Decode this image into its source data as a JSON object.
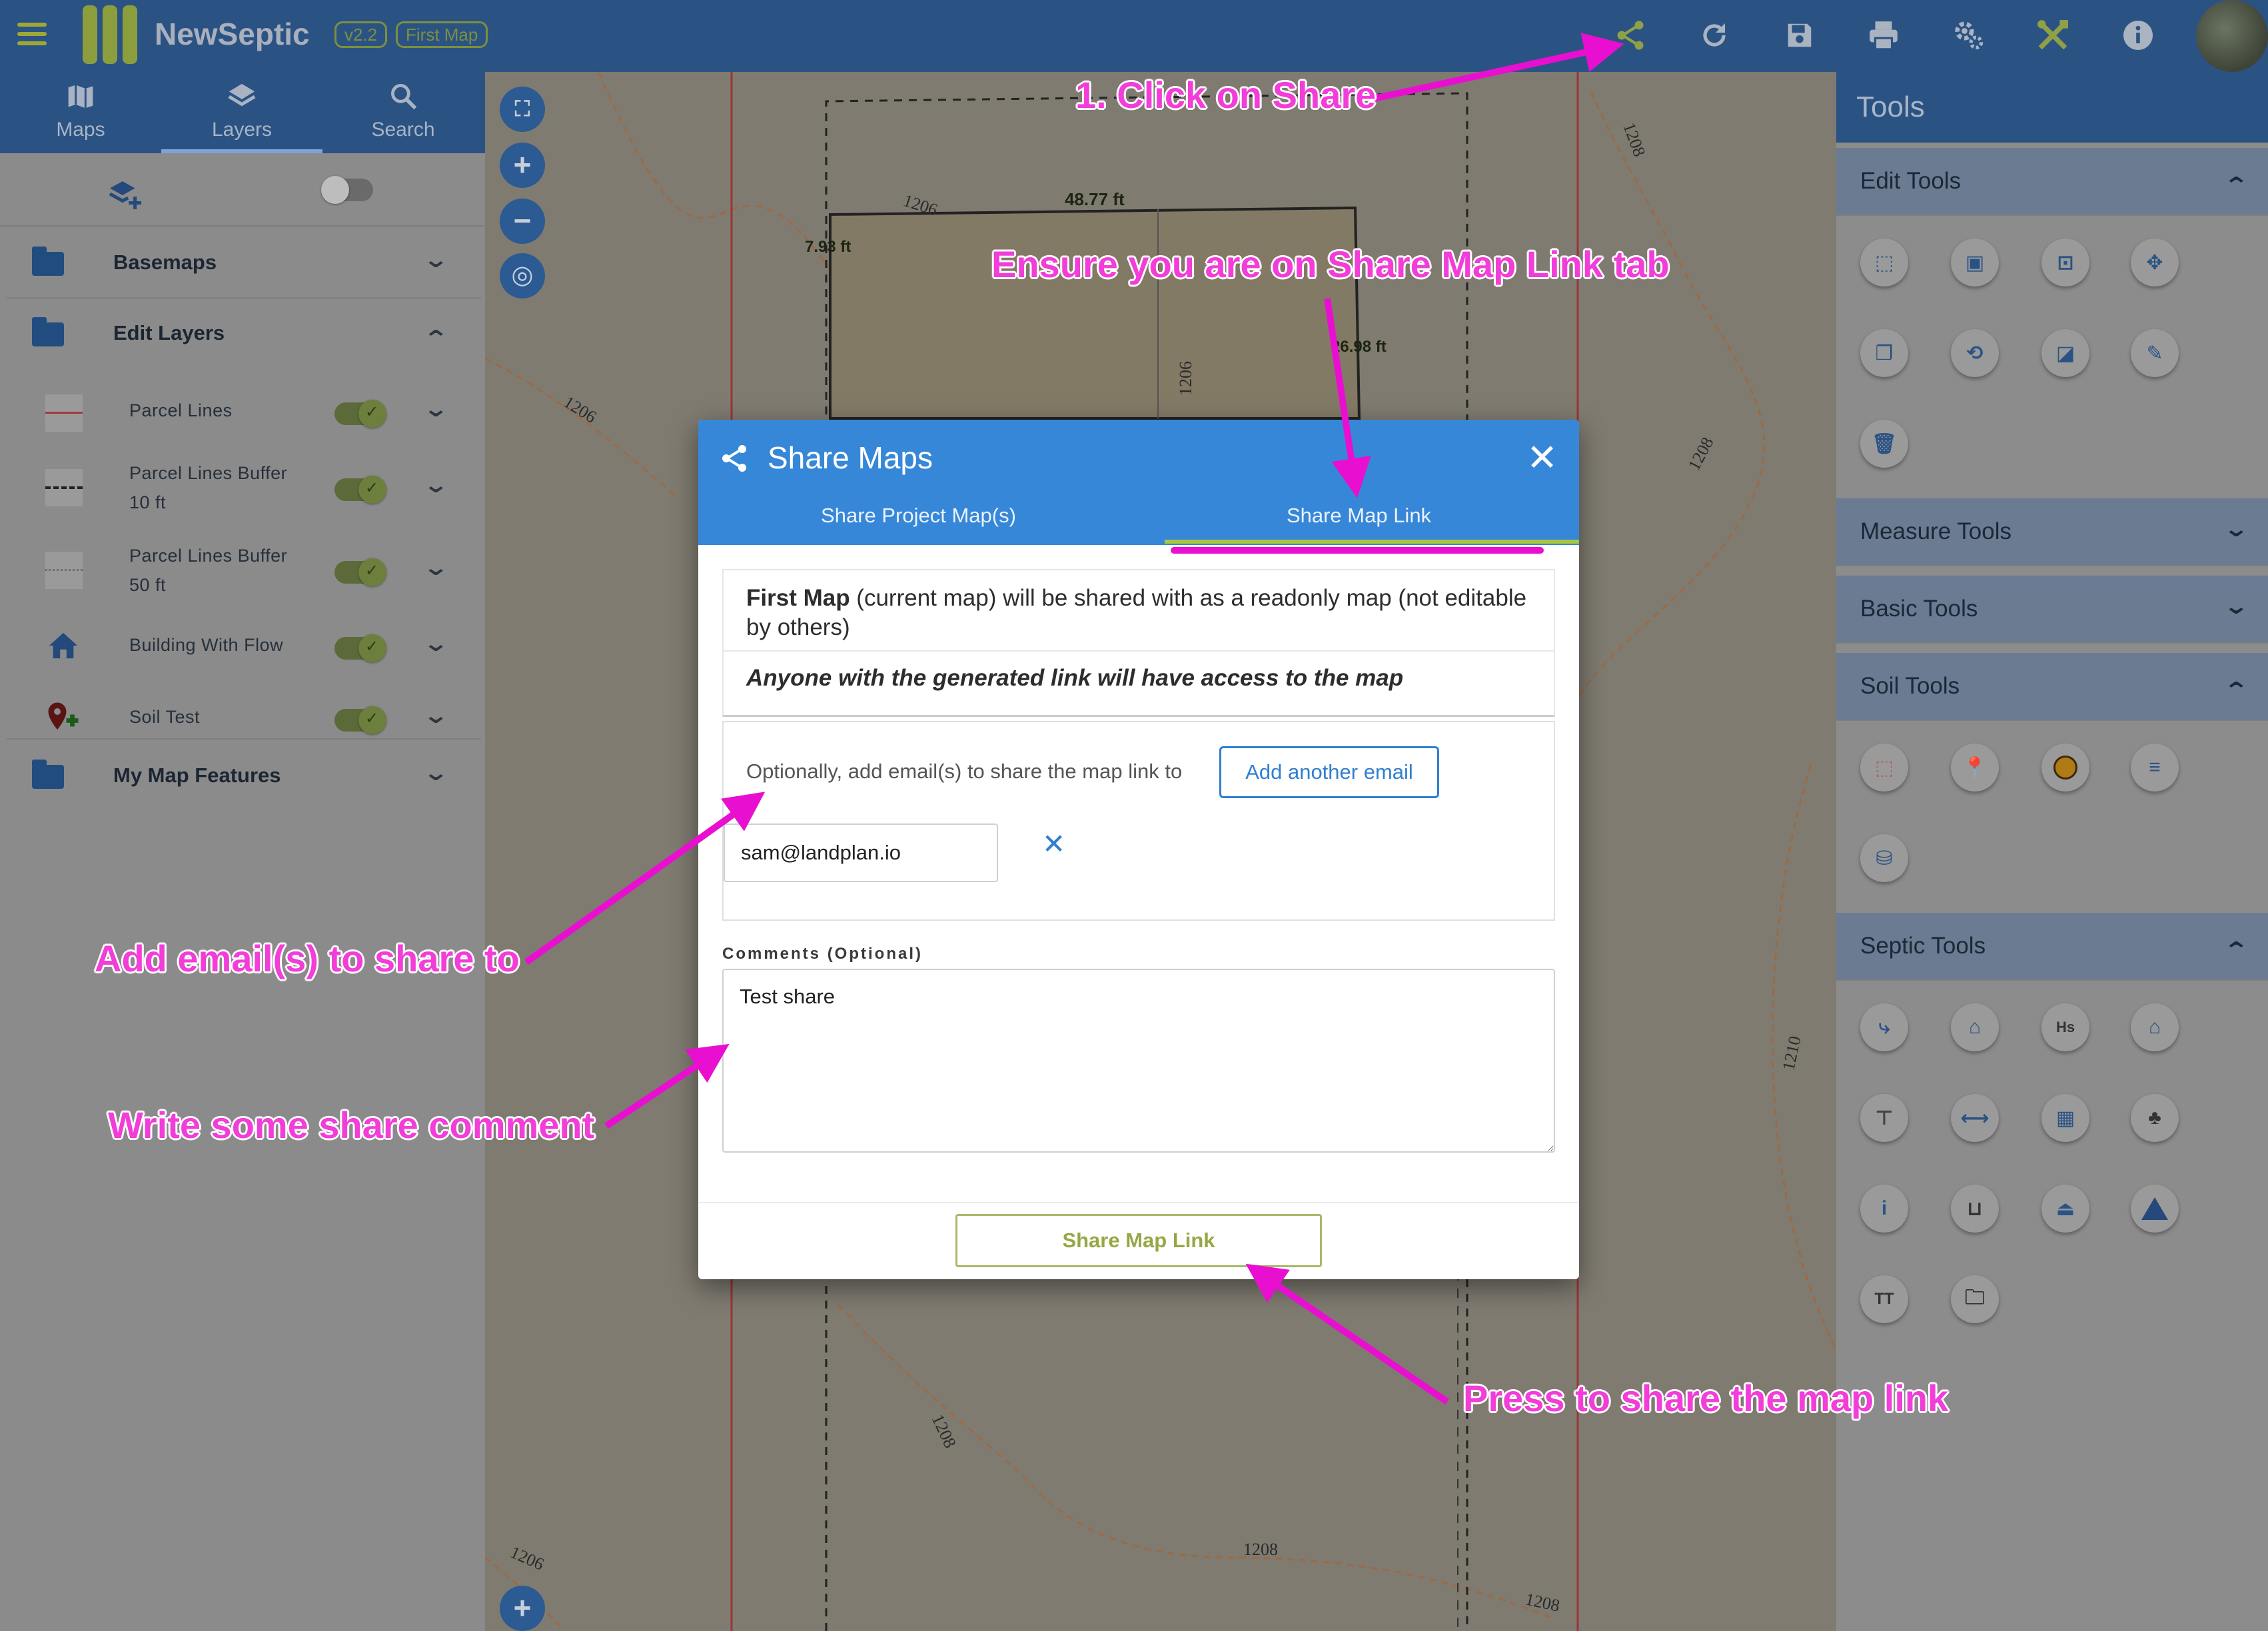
{
  "app": {
    "title": "NewSeptic",
    "version": "v2.2",
    "map_name": "First Map"
  },
  "topbar": {
    "icons": [
      "share-icon",
      "refresh-icon",
      "save-icon",
      "print-icon",
      "settings-icon",
      "tools-icon",
      "info-icon"
    ]
  },
  "left_panel": {
    "tabs": [
      {
        "label": "Maps",
        "icon": "map-icon"
      },
      {
        "label": "Layers",
        "icon": "layers-icon"
      },
      {
        "label": "Search",
        "icon": "search-icon"
      }
    ],
    "groups": {
      "basemaps": "Basemaps",
      "edit_layers": "Edit Layers",
      "my_map_features": "My Map Features"
    },
    "layers": [
      {
        "label": "Parcel Lines"
      },
      {
        "label": "Parcel Lines Buffer",
        "label2": "10 ft"
      },
      {
        "label": "Parcel Lines Buffer",
        "label2": "50 ft"
      },
      {
        "label": "Building With Flow"
      },
      {
        "label": "Soil Test"
      }
    ]
  },
  "map": {
    "labels": {
      "len1": "48.77 ft",
      "len2": "7.93 ft",
      "len3": "26.98 ft",
      "c1": "1206",
      "c2": "1206",
      "c3": "1206",
      "c4": "1208",
      "c5": "1208",
      "c6": "1208",
      "c7": "1208",
      "c8": "1210",
      "c9": "1206",
      "c10": "1208"
    }
  },
  "right_panel": {
    "title": "Tools",
    "sections": {
      "edit": "Edit Tools",
      "measure": "Measure Tools",
      "basic": "Basic Tools",
      "soil": "Soil Tools",
      "septic": "Septic Tools"
    }
  },
  "dialog": {
    "title": "Share Maps",
    "tabs": [
      "Share Project Map(s)",
      "Share Map Link"
    ],
    "info_map_name": "First Map",
    "info_rest": " (current map) will be shared with as a readonly map (not editable by others)",
    "info_access": "Anyone with the generated link will have access to the map",
    "email_hint": "Optionally, add email(s) to share the map link to",
    "add_email_button": "Add another email",
    "email_value": "sam@landplan.io",
    "comments_label": "Comments (Optional)",
    "comments_value": "Test share",
    "share_button": "Share Map Link"
  },
  "annotations": {
    "a1": "1. Click on Share",
    "a2": "Ensure you are on Share Map Link tab",
    "a3": "Add email(s) to share to",
    "a4": "Write some share comment",
    "a5": "Press to share the map link"
  },
  "colors": {
    "annotation": "#f23dd9",
    "header": "#2a5384",
    "dialog_header": "#3787d8"
  }
}
